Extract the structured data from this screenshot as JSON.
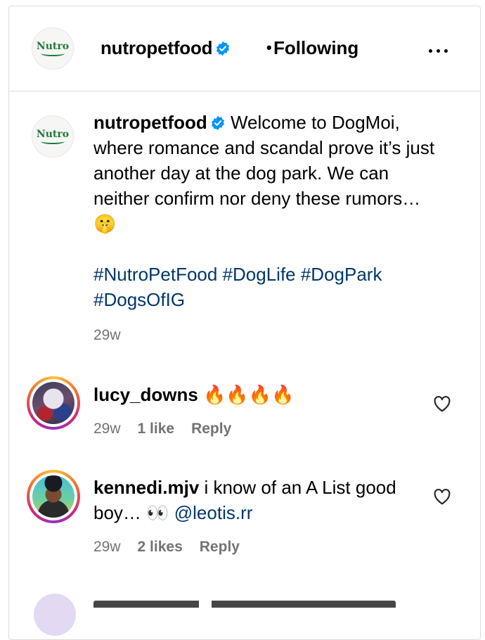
{
  "post": {
    "username": "nutropetfood",
    "follow_separator": "•",
    "follow_status": "Following",
    "logo_text": "Nutro"
  },
  "caption": {
    "username": "nutropetfood",
    "text": "Welcome to DogMoi, where romance and scandal prove it’s just another day at the dog park. We can neither confirm nor deny these rumors… 🤫",
    "hashtags": "#NutroPetFood #DogLife #DogPark #DogsOfIG",
    "time": "29w"
  },
  "comments": [
    {
      "username": "lucy_downs",
      "text": "🔥🔥🔥🔥",
      "time": "29w",
      "likes": "1 like",
      "reply": "Reply"
    },
    {
      "username": "kennedi.mjv",
      "text": "i know of an A List good boy… 👀",
      "mention": "@leotis.rr",
      "time": "29w",
      "likes": "2 likes",
      "reply": "Reply"
    }
  ],
  "colors": {
    "link": "#00376b",
    "muted": "#737373",
    "verified": "#0095f6",
    "border": "#dbdbdb"
  }
}
